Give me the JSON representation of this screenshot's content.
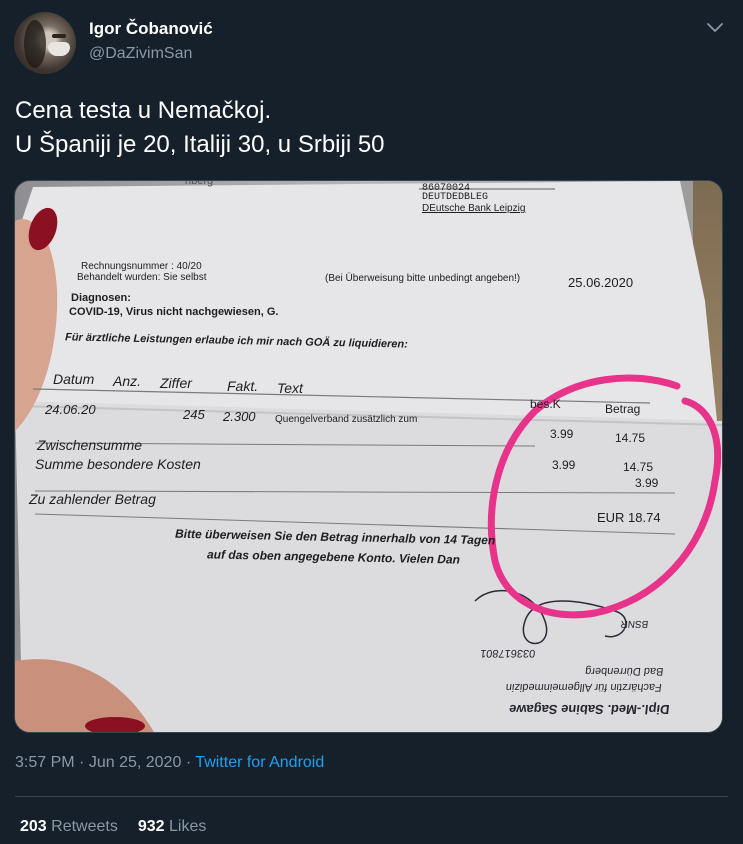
{
  "user": {
    "display_name": "Igor Čobanović",
    "handle": "@DaZivimSan"
  },
  "tweet": {
    "line1": "Cena testa u Nemačkoj.",
    "line2": "U Španiji je 20, Italiji 30, u Srbiji 50",
    "time": "3:57 PM",
    "date": "Jun 25, 2020",
    "separator": "·",
    "source": "Twitter for Android",
    "retweets": "203",
    "retweets_label": "Retweets",
    "likes": "932",
    "likes_label": "Likes"
  },
  "icons": {
    "caret": "chevron-down-icon"
  },
  "colors": {
    "background": "#15202b",
    "secondary_text": "#8899a6",
    "link": "#1da1f2",
    "divider": "#38444d",
    "highlight_circle": "#e8338a"
  },
  "invoice": {
    "top_fragment": "nberg",
    "bank_code": "86070024",
    "bank_line": "DEUTDEDBLEG",
    "bank_name": "DEutsche Bank Leipzig",
    "invoice_number": "Rechnungsnummer : 40/20",
    "treated": "Behandelt wurden: Sie selbst",
    "transfer_note": "(Bei Überweisung bitte unbedingt angeben!)",
    "invoice_date": "25.06.2020",
    "diagnosis_label": "Diagnosen:",
    "diagnosis": "COVID-19, Virus nicht nachgewiesen, G.",
    "liquidation_note": "Für ärztliche Leistungen erlaube ich mir nach GOÄ zu liquidieren:",
    "columns": {
      "date": "Datum",
      "count": "Anz.",
      "digit": "Ziffer",
      "factor": "Fakt.",
      "text": "Text",
      "special": "bes.K",
      "amount": "Betrag"
    },
    "row": {
      "date": "24.06.20",
      "digit": "245",
      "factor": "2.300",
      "text": "Quengelverband zusätzlich zum",
      "special": "3.99",
      "amount": "14.75"
    },
    "subtotal_label": "Zwischensumme",
    "special_costs_label": "Summe besondere Kosten",
    "special_costs_value": "3.99",
    "subtotal_value": "14.75",
    "special_value": "3.99",
    "total_label": "Zu zahlender Betrag",
    "total": "EUR 18.74",
    "pay_note_1": "Bitte überweisen Sie den Betrag innerhalb von 14 Tagen",
    "pay_note_2": "auf das oben angegebene Konto. Vielen Dan",
    "stamp_name": "Dipl.-Med. Sabine Sagawe",
    "stamp_specialty": "Fachärztin für Allgemeinmedizin",
    "stamp_place": "Bad Dürrenberg",
    "stamp_phone": "033617801",
    "stamp_bsnr": "BSNR"
  }
}
